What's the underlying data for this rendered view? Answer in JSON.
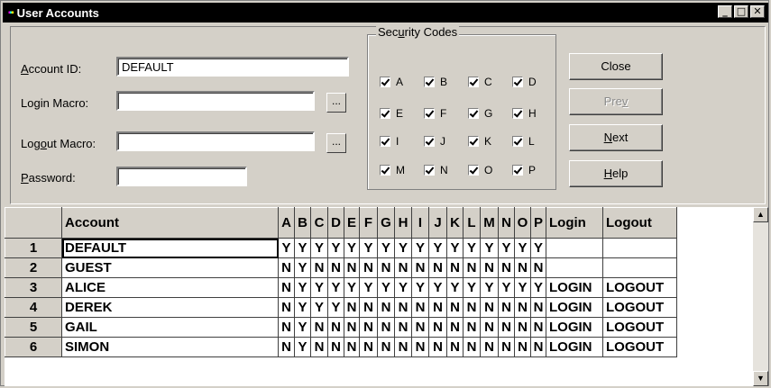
{
  "window": {
    "title": "User Accounts",
    "minimize": "_",
    "maximize": "□",
    "close": "✕"
  },
  "form": {
    "account_id": {
      "label_pre": "",
      "label_u": "A",
      "label_post": "ccount ID:",
      "value": "DEFAULT"
    },
    "login_macro": {
      "label_pre": "Lo",
      "label_u": "g",
      "label_post": "in Macro:",
      "value": ""
    },
    "logout_macro": {
      "label_pre": "Log",
      "label_u": "o",
      "label_post": "ut Macro:",
      "value": ""
    },
    "password": {
      "label_pre": "",
      "label_u": "P",
      "label_post": "assword:",
      "value": ""
    },
    "browse_label": "..."
  },
  "security": {
    "title_pre": "Sec",
    "title_u": "u",
    "title_post": "rity Codes",
    "codes": [
      "A",
      "B",
      "C",
      "D",
      "E",
      "F",
      "G",
      "H",
      "I",
      "J",
      "K",
      "L",
      "M",
      "N",
      "O",
      "P"
    ]
  },
  "buttons": {
    "close": "Close",
    "prev_pre": "Pre",
    "prev_u": "v",
    "prev_post": "",
    "next_pre": "",
    "next_u": "N",
    "next_post": "ext",
    "help_pre": "",
    "help_u": "H",
    "help_post": "elp"
  },
  "grid": {
    "columns": [
      "Account",
      "A",
      "B",
      "C",
      "D",
      "E",
      "F",
      "G",
      "H",
      "I",
      "J",
      "K",
      "L",
      "M",
      "N",
      "O",
      "P",
      "Login",
      "Logout"
    ],
    "rows": [
      {
        "n": "1",
        "account": "DEFAULT",
        "flags": [
          "Y",
          "Y",
          "Y",
          "Y",
          "Y",
          "Y",
          "Y",
          "Y",
          "Y",
          "Y",
          "Y",
          "Y",
          "Y",
          "Y",
          "Y",
          "Y"
        ],
        "login": "",
        "logout": ""
      },
      {
        "n": "2",
        "account": "GUEST",
        "flags": [
          "N",
          "Y",
          "N",
          "N",
          "N",
          "N",
          "N",
          "N",
          "N",
          "N",
          "N",
          "N",
          "N",
          "N",
          "N",
          "N"
        ],
        "login": "",
        "logout": ""
      },
      {
        "n": "3",
        "account": "ALICE",
        "flags": [
          "N",
          "Y",
          "Y",
          "Y",
          "Y",
          "Y",
          "Y",
          "Y",
          "Y",
          "Y",
          "Y",
          "Y",
          "Y",
          "Y",
          "Y",
          "Y"
        ],
        "login": "LOGIN",
        "logout": "LOGOUT"
      },
      {
        "n": "4",
        "account": "DEREK",
        "flags": [
          "N",
          "Y",
          "Y",
          "Y",
          "N",
          "N",
          "N",
          "N",
          "N",
          "N",
          "N",
          "N",
          "N",
          "N",
          "N",
          "N"
        ],
        "login": "LOGIN",
        "logout": "LOGOUT"
      },
      {
        "n": "5",
        "account": "GAIL",
        "flags": [
          "N",
          "Y",
          "N",
          "N",
          "N",
          "N",
          "N",
          "N",
          "N",
          "N",
          "N",
          "N",
          "N",
          "N",
          "N",
          "N"
        ],
        "login": "LOGIN",
        "logout": "LOGOUT"
      },
      {
        "n": "6",
        "account": "SIMON",
        "flags": [
          "N",
          "Y",
          "N",
          "N",
          "N",
          "N",
          "N",
          "N",
          "N",
          "N",
          "N",
          "N",
          "N",
          "N",
          "N",
          "N"
        ],
        "login": "LOGIN",
        "logout": "LOGOUT"
      }
    ]
  },
  "scrollbar": {
    "up": "▲",
    "down": "▼"
  }
}
